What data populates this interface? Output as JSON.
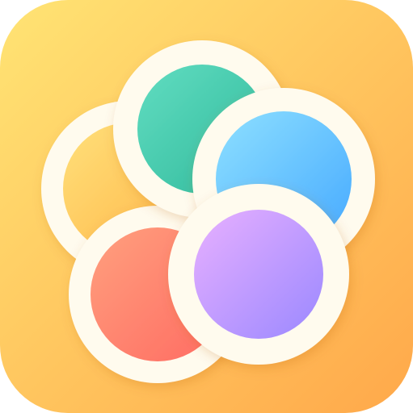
{
  "app_icon": {
    "icon_name": "photo-petals-app-icon",
    "petal_count": 5,
    "colors": {
      "background_start": "#FFE474",
      "background_end": "#FFA84A",
      "ring": "#FFFBEE",
      "petal_yellow_start": "#FFE07A",
      "petal_yellow_end": "#FFB547",
      "petal_green_start": "#62DDC1",
      "petal_green_end": "#2EB89A",
      "petal_blue_start": "#8EE0FF",
      "petal_blue_end": "#45A9FF",
      "petal_purple_start": "#E8B0FF",
      "petal_purple_end": "#9A88FF",
      "petal_red_start": "#FFA07E",
      "petal_red_end": "#FF6B62"
    }
  }
}
